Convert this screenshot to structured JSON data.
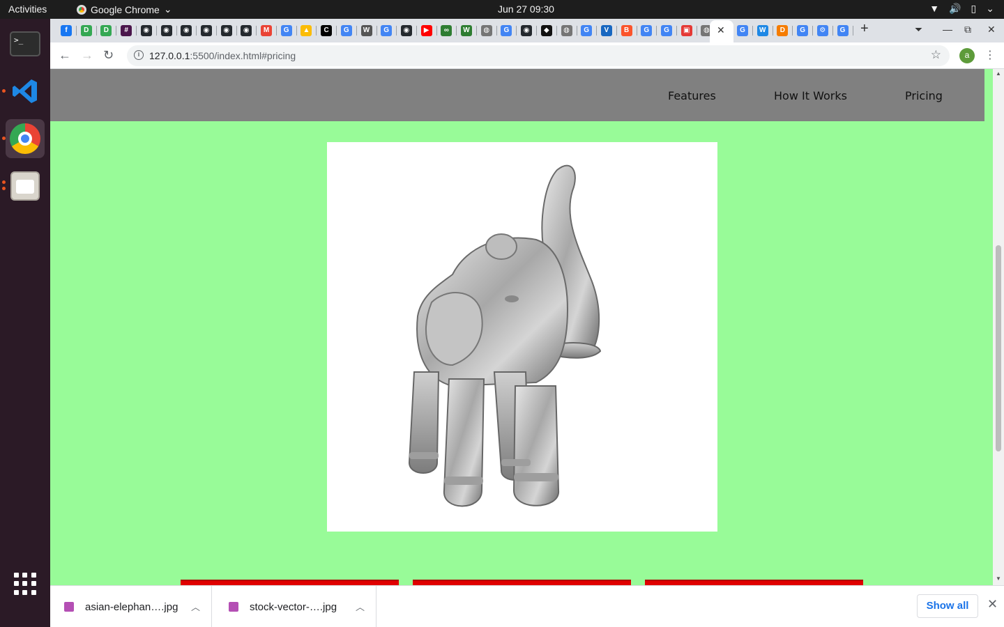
{
  "system": {
    "activities": "Activities",
    "app_name": "Google Chrome",
    "clock": "Jun 27  09:30"
  },
  "dock": {
    "items": [
      "terminal-icon",
      "vscode-icon",
      "chrome-icon",
      "files-icon"
    ],
    "show_apps_icon": "apps-grid-icon"
  },
  "browser": {
    "tab_favicons": [
      {
        "icon": "facebook-icon",
        "color": "#1877f2",
        "glyph": "f"
      },
      {
        "icon": "doc-icon",
        "color": "#34a853",
        "glyph": "D"
      },
      {
        "icon": "doc-icon",
        "color": "#34a853",
        "glyph": "D"
      },
      {
        "icon": "slack-icon",
        "color": "#4a154b",
        "glyph": "#"
      },
      {
        "icon": "github-icon",
        "color": "#24292e",
        "glyph": "◉"
      },
      {
        "icon": "github-icon",
        "color": "#24292e",
        "glyph": "◉"
      },
      {
        "icon": "github-icon",
        "color": "#24292e",
        "glyph": "◉"
      },
      {
        "icon": "github-icon",
        "color": "#24292e",
        "glyph": "◉"
      },
      {
        "icon": "github-icon",
        "color": "#24292e",
        "glyph": "◉"
      },
      {
        "icon": "github-icon",
        "color": "#24292e",
        "glyph": "◉"
      },
      {
        "icon": "gmail-icon",
        "color": "#ea4335",
        "glyph": "M"
      },
      {
        "icon": "google-icon",
        "color": "#4285f4",
        "glyph": "G"
      },
      {
        "icon": "drive-icon",
        "color": "#fbbc05",
        "glyph": "▲"
      },
      {
        "icon": "codepen-icon",
        "color": "#000000",
        "glyph": "C"
      },
      {
        "icon": "google-icon",
        "color": "#4285f4",
        "glyph": "G"
      },
      {
        "icon": "wikipedia-icon",
        "color": "#555555",
        "glyph": "W"
      },
      {
        "icon": "google-icon",
        "color": "#4285f4",
        "glyph": "G"
      },
      {
        "icon": "github-icon",
        "color": "#24292e",
        "glyph": "◉"
      },
      {
        "icon": "youtube-icon",
        "color": "#ff0000",
        "glyph": "▶"
      },
      {
        "icon": "link-icon",
        "color": "#2e7d32",
        "glyph": "∞"
      },
      {
        "icon": "w-icon",
        "color": "#2e7d32",
        "glyph": "W"
      },
      {
        "icon": "globe-icon",
        "color": "#757575",
        "glyph": "◍"
      },
      {
        "icon": "google-icon",
        "color": "#4285f4",
        "glyph": "G"
      },
      {
        "icon": "github-icon",
        "color": "#24292e",
        "glyph": "◉"
      },
      {
        "icon": "codesandbox-icon",
        "color": "#111111",
        "glyph": "◆"
      },
      {
        "icon": "globe-icon",
        "color": "#757575",
        "glyph": "◍"
      },
      {
        "icon": "google-icon",
        "color": "#4285f4",
        "glyph": "G"
      },
      {
        "icon": "vuetify-icon",
        "color": "#1867c0",
        "glyph": "V"
      },
      {
        "icon": "brave-icon",
        "color": "#fb542b",
        "glyph": "B"
      },
      {
        "icon": "google-icon",
        "color": "#4285f4",
        "glyph": "G"
      },
      {
        "icon": "google-icon",
        "color": "#4285f4",
        "glyph": "G"
      },
      {
        "icon": "red-app-icon",
        "color": "#e53935",
        "glyph": "▣"
      },
      {
        "icon": "globe-icon",
        "color": "#757575",
        "glyph": "◍"
      }
    ],
    "tab_favicons_after": [
      {
        "icon": "google-icon",
        "color": "#4285f4",
        "glyph": "G"
      },
      {
        "icon": "w-icon",
        "color": "#1e88e5",
        "glyph": "W"
      },
      {
        "icon": "d-icon",
        "color": "#f57c00",
        "glyph": "D"
      },
      {
        "icon": "google-icon",
        "color": "#4285f4",
        "glyph": "G"
      },
      {
        "icon": "js-icon",
        "color": "#4285f4",
        "glyph": "⚙"
      },
      {
        "icon": "google-icon",
        "color": "#4285f4",
        "glyph": "G"
      }
    ],
    "url_host": "127.0.0.1",
    "url_rest": ":5500/index.html#pricing",
    "profile_initial": "a"
  },
  "page": {
    "nav": [
      "Features",
      "How It Works",
      "Pricing"
    ],
    "image_subject": "silver-elephant-statue-image",
    "accent_color": "#98fb98",
    "nav_color": "#808080",
    "card_color": "#e00000"
  },
  "downloads": {
    "files": [
      "asian-elephan….jpg",
      "stock-vector-….jpg"
    ],
    "show_all": "Show all"
  }
}
